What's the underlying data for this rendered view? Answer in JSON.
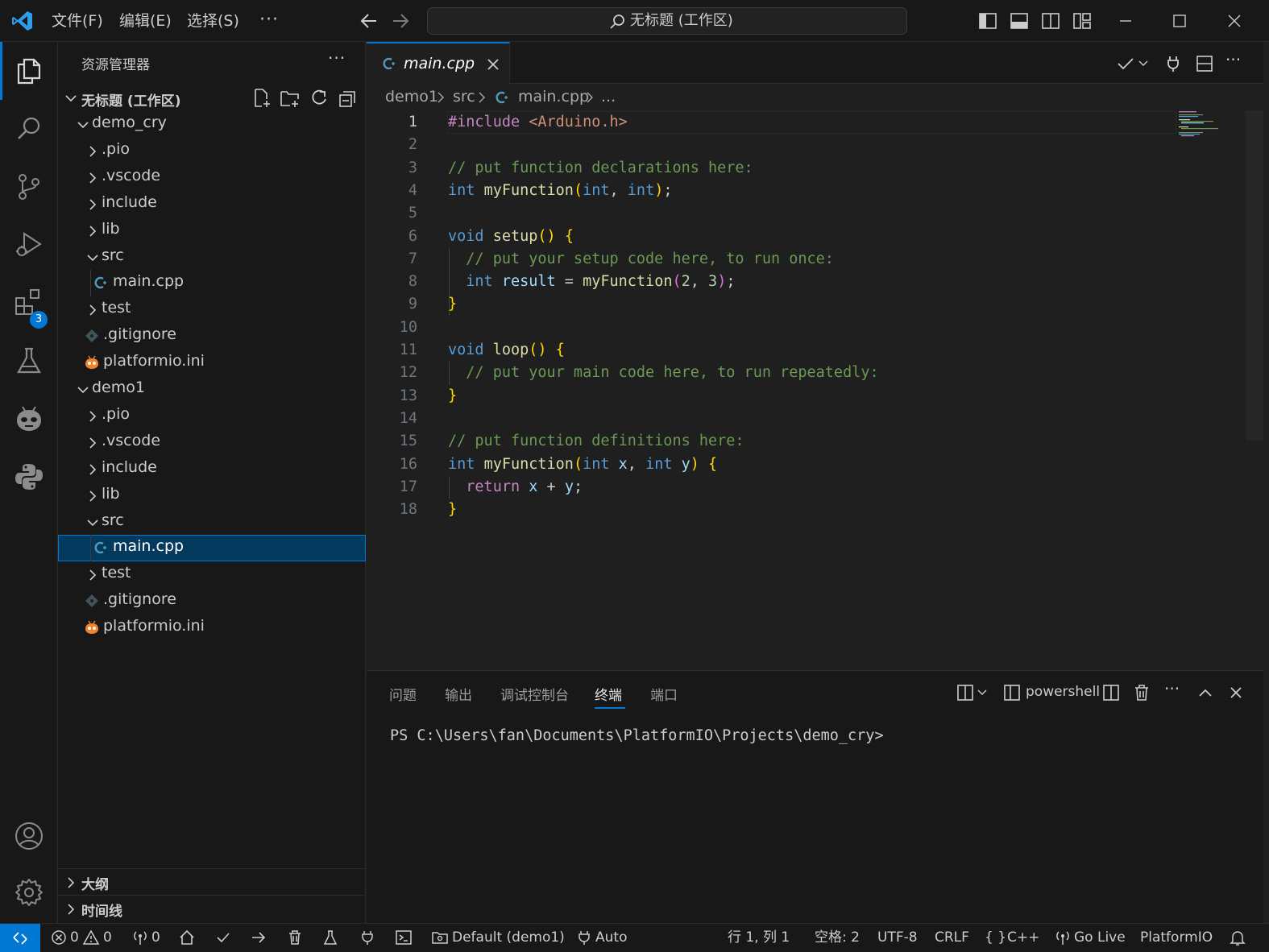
{
  "titlebar": {
    "menus": [
      "文件(F)",
      "编辑(E)",
      "选择(S)"
    ],
    "more": "···",
    "command_center": "无标题 (工作区)"
  },
  "activitybar": {
    "extensions_badge": "3"
  },
  "sidebar": {
    "title": "资源管理器",
    "more": "···",
    "workspace": "无标题 (工作区)",
    "tree": [
      {
        "label": "demo_cry",
        "depth": 1,
        "kind": "folder-open"
      },
      {
        "label": ".pio",
        "depth": 2,
        "kind": "folder"
      },
      {
        "label": ".vscode",
        "depth": 2,
        "kind": "folder"
      },
      {
        "label": "include",
        "depth": 2,
        "kind": "folder"
      },
      {
        "label": "lib",
        "depth": 2,
        "kind": "folder"
      },
      {
        "label": "src",
        "depth": 2,
        "kind": "folder-open"
      },
      {
        "label": "main.cpp",
        "depth": 3,
        "kind": "cpp"
      },
      {
        "label": "test",
        "depth": 2,
        "kind": "folder"
      },
      {
        "label": ".gitignore",
        "depth": 2,
        "kind": "git"
      },
      {
        "label": "platformio.ini",
        "depth": 2,
        "kind": "pio"
      },
      {
        "label": "demo1",
        "depth": 1,
        "kind": "folder-open"
      },
      {
        "label": ".pio",
        "depth": 2,
        "kind": "folder"
      },
      {
        "label": ".vscode",
        "depth": 2,
        "kind": "folder"
      },
      {
        "label": "include",
        "depth": 2,
        "kind": "folder"
      },
      {
        "label": "lib",
        "depth": 2,
        "kind": "folder"
      },
      {
        "label": "src",
        "depth": 2,
        "kind": "folder-open"
      },
      {
        "label": "main.cpp",
        "depth": 3,
        "kind": "cpp",
        "selected": true
      },
      {
        "label": "test",
        "depth": 2,
        "kind": "folder"
      },
      {
        "label": ".gitignore",
        "depth": 2,
        "kind": "git"
      },
      {
        "label": "platformio.ini",
        "depth": 2,
        "kind": "pio"
      }
    ],
    "outline": "大纲",
    "timeline": "时间线"
  },
  "editor": {
    "tab_label": "main.cpp",
    "breadcrumb": [
      "demo1",
      "src",
      "main.cpp",
      "..."
    ],
    "code_lines": [
      [
        [
          "ctrl",
          "#include "
        ],
        [
          "str",
          "<Arduino.h>"
        ]
      ],
      [],
      [
        [
          "cmt",
          "// put function declarations here:"
        ]
      ],
      [
        [
          "kw",
          "int "
        ],
        [
          "fn",
          "myFunction"
        ],
        [
          "b1",
          "("
        ],
        [
          "kw",
          "int"
        ],
        [
          "p",
          ", "
        ],
        [
          "kw",
          "int"
        ],
        [
          "b1",
          ")"
        ],
        [
          "p",
          ";"
        ]
      ],
      [],
      [
        [
          "kw",
          "void "
        ],
        [
          "fn",
          "setup"
        ],
        [
          "b1",
          "() {"
        ]
      ],
      [
        [
          "p",
          "  "
        ],
        [
          "cmt",
          "// put your setup code here, to run once:"
        ]
      ],
      [
        [
          "p",
          "  "
        ],
        [
          "kw",
          "int "
        ],
        [
          "var",
          "result"
        ],
        [
          "p",
          " = "
        ],
        [
          "fn",
          "myFunction"
        ],
        [
          "b2",
          "("
        ],
        [
          "num",
          "2"
        ],
        [
          "p",
          ", "
        ],
        [
          "num",
          "3"
        ],
        [
          "b2",
          ")"
        ],
        [
          "p",
          ";"
        ]
      ],
      [
        [
          "b1",
          "}"
        ]
      ],
      [],
      [
        [
          "kw",
          "void "
        ],
        [
          "fn",
          "loop"
        ],
        [
          "b1",
          "() {"
        ]
      ],
      [
        [
          "p",
          "  "
        ],
        [
          "cmt",
          "// put your main code here, to run repeatedly:"
        ]
      ],
      [
        [
          "b1",
          "}"
        ]
      ],
      [],
      [
        [
          "cmt",
          "// put function definitions here:"
        ]
      ],
      [
        [
          "kw",
          "int "
        ],
        [
          "fn",
          "myFunction"
        ],
        [
          "b1",
          "("
        ],
        [
          "kw",
          "int "
        ],
        [
          "var",
          "x"
        ],
        [
          "p",
          ", "
        ],
        [
          "kw",
          "int "
        ],
        [
          "var",
          "y"
        ],
        [
          "b1",
          ") {"
        ]
      ],
      [
        [
          "p",
          "  "
        ],
        [
          "ctrl",
          "return "
        ],
        [
          "var",
          "x"
        ],
        [
          "p",
          " + "
        ],
        [
          "var",
          "y"
        ],
        [
          "p",
          ";"
        ]
      ],
      [
        [
          "b1",
          "}"
        ]
      ]
    ]
  },
  "panel": {
    "tabs": [
      "问题",
      "输出",
      "调试控制台",
      "终端",
      "端口"
    ],
    "active_tab": "终端",
    "terminal_name": "powershell",
    "more": "···",
    "terminal_text": "PS C:\\Users\\fan\\Documents\\PlatformIO\\Projects\\demo_cry>"
  },
  "statusbar": {
    "errors": "0",
    "warnings": "0",
    "ports": "0",
    "env": "Default (demo1)",
    "auto": "Auto",
    "position": "行 1, 列 1",
    "spaces": "空格: 2",
    "encoding": "UTF-8",
    "eol": "CRLF",
    "language": "C++",
    "golive": "Go Live",
    "platformio": "PlatformIO"
  },
  "colors": {
    "accent": "#0078d4",
    "background": "#1f1f1f",
    "sidebar": "#181818",
    "selection": "#04395e"
  }
}
